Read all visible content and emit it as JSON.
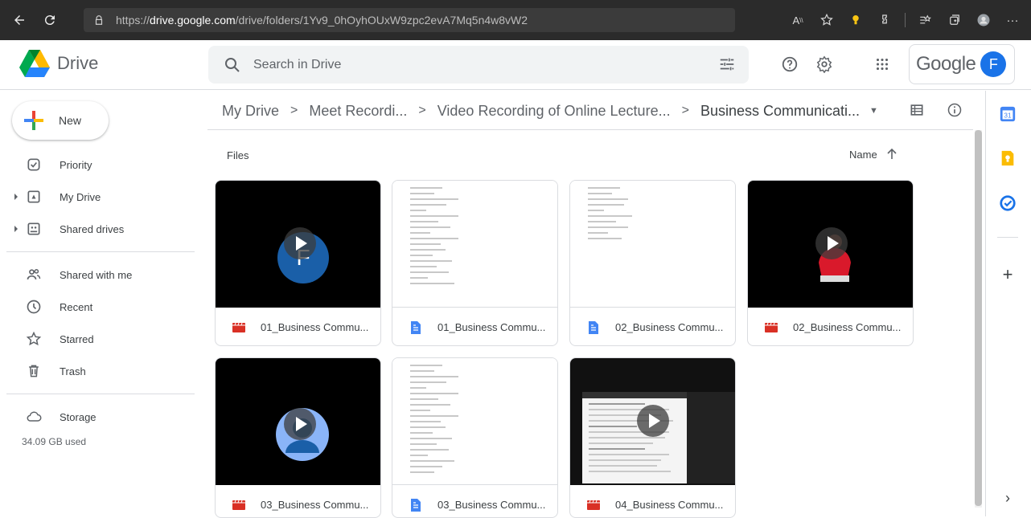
{
  "browser": {
    "url_prefix": "https://",
    "url_host": "drive.google.com",
    "url_path": "/drive/folders/1Yv9_0hOyhOUxW9zpc2evA7Mq5n4w8vW2"
  },
  "header": {
    "app_name": "Drive",
    "search_placeholder": "Search in Drive",
    "google_word": "Google",
    "avatar_initial": "F"
  },
  "sidebar": {
    "new_label": "New",
    "items": [
      {
        "label": "Priority",
        "icon": "priority-check-icon"
      },
      {
        "label": "My Drive",
        "icon": "my-drive-icon"
      },
      {
        "label": "Shared drives",
        "icon": "shared-drives-icon"
      },
      {
        "label": "Shared with me",
        "icon": "people-icon"
      },
      {
        "label": "Recent",
        "icon": "clock-icon"
      },
      {
        "label": "Starred",
        "icon": "star-icon"
      },
      {
        "label": "Trash",
        "icon": "trash-icon"
      },
      {
        "label": "Storage",
        "icon": "cloud-icon"
      }
    ],
    "storage_used": "34.09 GB used"
  },
  "breadcrumb": {
    "items": [
      "My Drive",
      "Meet Recordi...",
      "Video Recording of Online Lecture...",
      "Business Communicati..."
    ],
    "separator": ">"
  },
  "main": {
    "section_label": "Files",
    "sort_label": "Name",
    "files": [
      {
        "name": "01_Business Commu...",
        "type": "video"
      },
      {
        "name": "01_Business Commu...",
        "type": "doc"
      },
      {
        "name": "02_Business Commu...",
        "type": "doc"
      },
      {
        "name": "02_Business Commu...",
        "type": "video"
      },
      {
        "name": "03_Business Commu...",
        "type": "video"
      },
      {
        "name": "03_Business Commu...",
        "type": "doc"
      },
      {
        "name": "04_Business Commu...",
        "type": "video"
      }
    ]
  },
  "thumbs": {
    "f_initial": "F"
  },
  "colors": {
    "video_red": "#d93025",
    "doc_blue": "#4285f4",
    "accent_blue": "#1a73e8"
  }
}
